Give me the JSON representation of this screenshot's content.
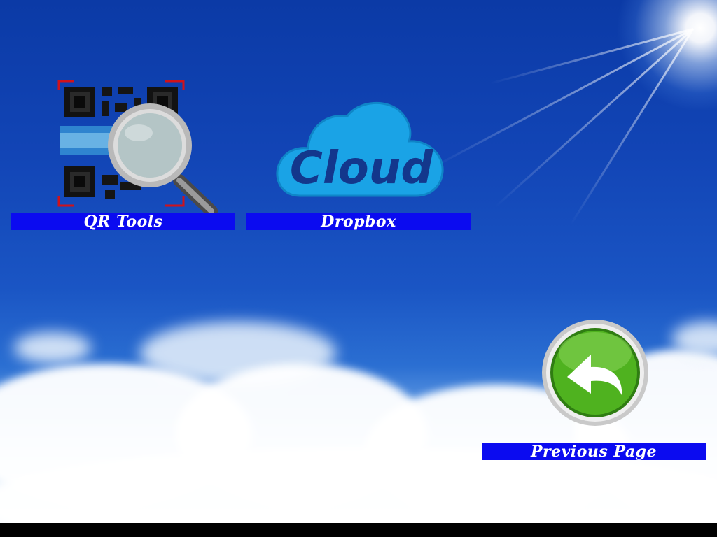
{
  "apps": [
    {
      "label": "QR Tools",
      "icon": "qr-search-icon"
    },
    {
      "label": "Dropbox",
      "icon": "cloud-icon",
      "icon_text": "Cloud"
    }
  ],
  "navigation": {
    "previous_label": "Previous Page",
    "icon": "back-arrow-icon"
  },
  "colors": {
    "label_bar": "#0b0bf0",
    "sky_top": "#0b3aa6",
    "back_button": "#3f9a1c"
  }
}
